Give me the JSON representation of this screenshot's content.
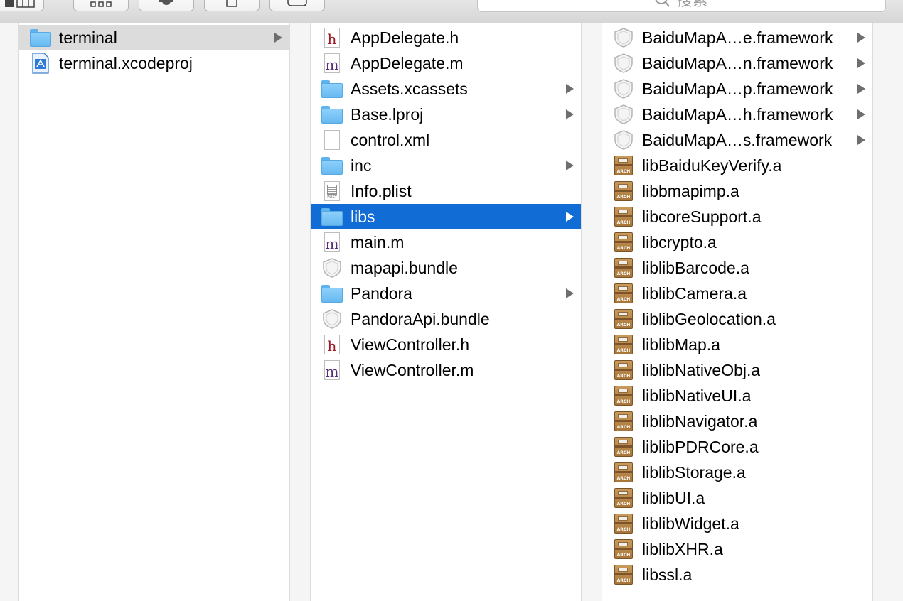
{
  "toolbar": {
    "buttons": [
      {
        "name": "view-mode-button",
        "icon": "column-view-icon"
      },
      {
        "name": "arrange-button",
        "icon": "grid-icon"
      },
      {
        "name": "action-button",
        "icon": "gear-icon"
      },
      {
        "name": "share-button",
        "icon": "share-icon"
      },
      {
        "name": "tags-button",
        "icon": "tag-icon"
      }
    ],
    "search_placeholder": "搜索"
  },
  "column1": {
    "items": [
      {
        "label": "terminal",
        "icon": "folder-icon",
        "has_children": true,
        "selected": true
      },
      {
        "label": "terminal.xcodeproj",
        "icon": "xcodeproj-icon",
        "has_children": false,
        "selected": false
      }
    ]
  },
  "column2": {
    "items": [
      {
        "label": "AppDelegate.h",
        "icon": "h-file-icon",
        "has_children": false
      },
      {
        "label": "AppDelegate.m",
        "icon": "m-file-icon",
        "has_children": false
      },
      {
        "label": "Assets.xcassets",
        "icon": "folder-icon",
        "has_children": true
      },
      {
        "label": "Base.lproj",
        "icon": "folder-icon",
        "has_children": true
      },
      {
        "label": "control.xml",
        "icon": "blank-file-icon",
        "has_children": false
      },
      {
        "label": "inc",
        "icon": "folder-icon",
        "has_children": true
      },
      {
        "label": "Info.plist",
        "icon": "plist-icon",
        "has_children": false
      },
      {
        "label": "libs",
        "icon": "folder-icon",
        "has_children": true,
        "selected": true
      },
      {
        "label": "main.m",
        "icon": "m-file-icon",
        "has_children": false
      },
      {
        "label": "mapapi.bundle",
        "icon": "bundle-icon",
        "has_children": false
      },
      {
        "label": "Pandora",
        "icon": "folder-icon",
        "has_children": true
      },
      {
        "label": "PandoraApi.bundle",
        "icon": "bundle-icon",
        "has_children": false
      },
      {
        "label": "ViewController.h",
        "icon": "h-file-icon",
        "has_children": false
      },
      {
        "label": "ViewController.m",
        "icon": "m-file-icon",
        "has_children": false
      }
    ]
  },
  "column3": {
    "items": [
      {
        "label": "BaiduMapA…e.framework",
        "icon": "framework-icon",
        "has_children": true
      },
      {
        "label": "BaiduMapA…n.framework",
        "icon": "framework-icon",
        "has_children": true
      },
      {
        "label": "BaiduMapA…p.framework",
        "icon": "framework-icon",
        "has_children": true
      },
      {
        "label": "BaiduMapA…h.framework",
        "icon": "framework-icon",
        "has_children": true
      },
      {
        "label": "BaiduMapA…s.framework",
        "icon": "framework-icon",
        "has_children": true
      },
      {
        "label": "libBaiduKeyVerify.a",
        "icon": "archive-icon",
        "has_children": false
      },
      {
        "label": "libbmapimp.a",
        "icon": "archive-icon",
        "has_children": false
      },
      {
        "label": "libcoreSupport.a",
        "icon": "archive-icon",
        "has_children": false
      },
      {
        "label": "libcrypto.a",
        "icon": "archive-icon",
        "has_children": false
      },
      {
        "label": "liblibBarcode.a",
        "icon": "archive-icon",
        "has_children": false
      },
      {
        "label": "liblibCamera.a",
        "icon": "archive-icon",
        "has_children": false
      },
      {
        "label": "liblibGeolocation.a",
        "icon": "archive-icon",
        "has_children": false
      },
      {
        "label": "liblibMap.a",
        "icon": "archive-icon",
        "has_children": false
      },
      {
        "label": "liblibNativeObj.a",
        "icon": "archive-icon",
        "has_children": false
      },
      {
        "label": "liblibNativeUI.a",
        "icon": "archive-icon",
        "has_children": false
      },
      {
        "label": "liblibNavigator.a",
        "icon": "archive-icon",
        "has_children": false
      },
      {
        "label": "liblibPDRCore.a",
        "icon": "archive-icon",
        "has_children": false
      },
      {
        "label": "liblibStorage.a",
        "icon": "archive-icon",
        "has_children": false
      },
      {
        "label": "liblibUI.a",
        "icon": "archive-icon",
        "has_children": false
      },
      {
        "label": "liblibWidget.a",
        "icon": "archive-icon",
        "has_children": false
      },
      {
        "label": "liblibXHR.a",
        "icon": "archive-icon",
        "has_children": false
      },
      {
        "label": "libssl.a",
        "icon": "archive-icon",
        "has_children": false
      }
    ]
  },
  "icon_text": {
    "h": "h",
    "m": "m",
    "plist": "PLIST",
    "arch": "ARCH"
  },
  "colors": {
    "selection_blue": "#116cd6",
    "selection_gray": "#dcdcdc",
    "folder": "#74c0f4"
  }
}
